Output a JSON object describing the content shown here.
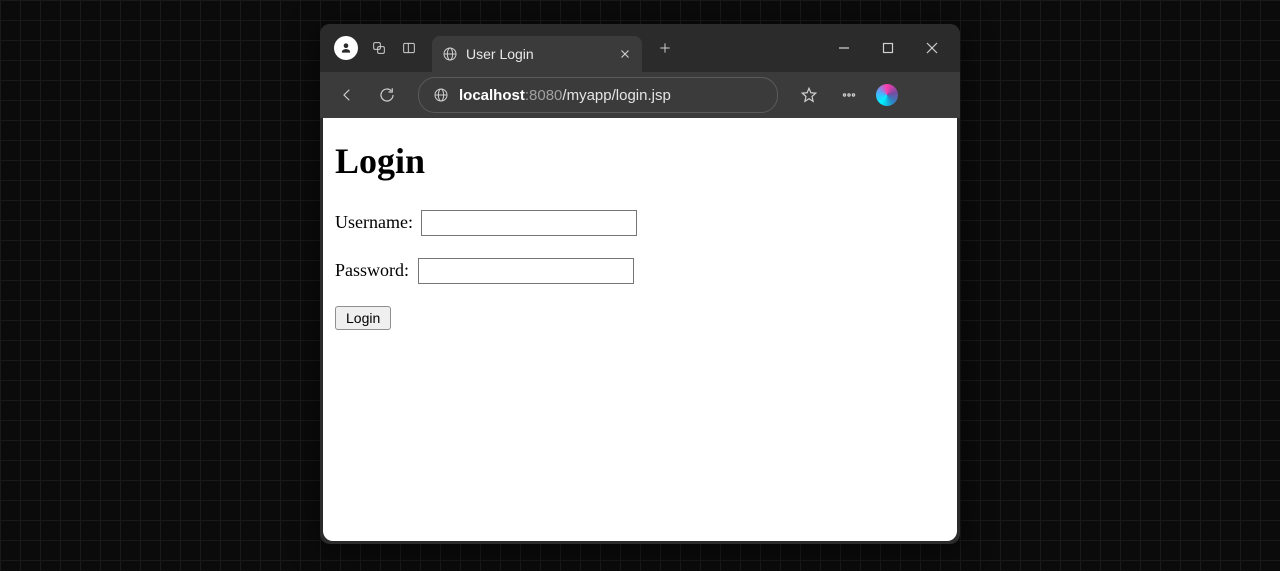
{
  "tab": {
    "title": "User Login"
  },
  "address": {
    "host": "localhost",
    "port": ":8080",
    "path": "/myapp/login.jsp"
  },
  "page": {
    "heading": "Login",
    "username_label": "Username:",
    "password_label": "Password:",
    "username_value": "",
    "password_value": "",
    "submit_label": "Login"
  }
}
